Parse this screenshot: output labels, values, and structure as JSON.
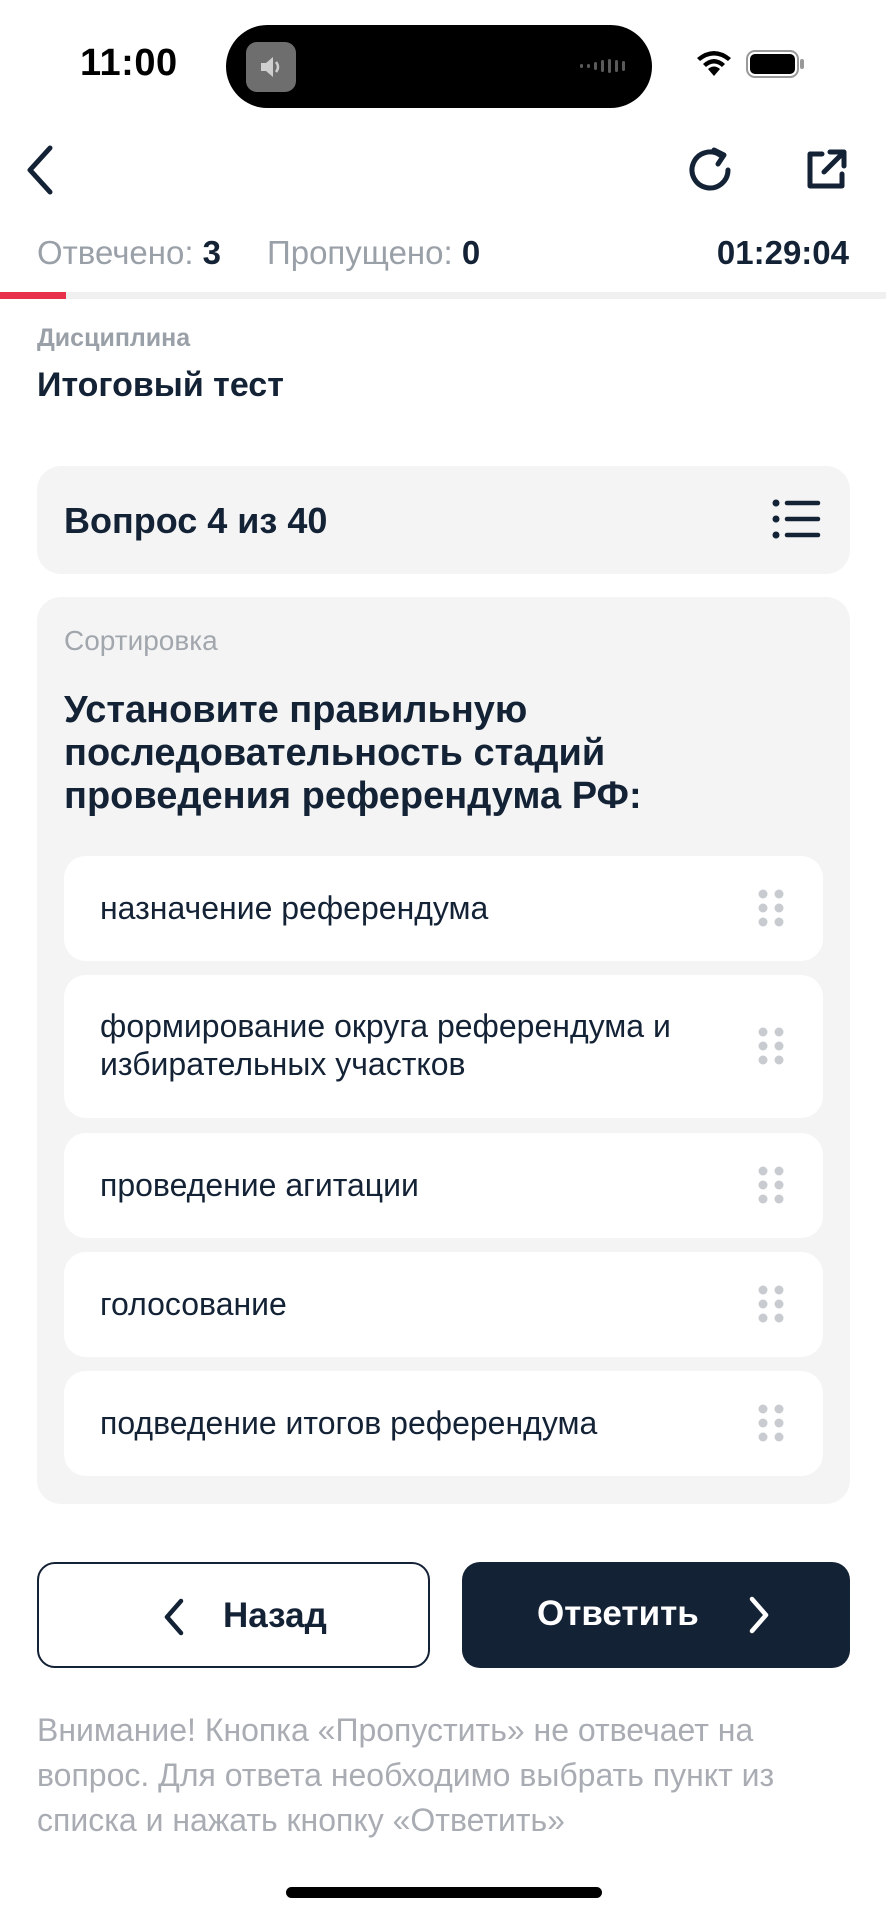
{
  "status_bar": {
    "time": "11:00"
  },
  "header": {
    "back_icon": "chevron-left-icon",
    "refresh_icon": "refresh-icon",
    "share_icon": "external-link-icon"
  },
  "stats": {
    "answered_label": "Отвечено:",
    "answered_value": "3",
    "skipped_label": "Пропущено:",
    "skipped_value": "0",
    "timer": "01:29:04",
    "progress_fraction": 0.075,
    "accent_color": "#e8304a"
  },
  "discipline": {
    "label": "Дисциплина",
    "title": "Итоговый тест"
  },
  "question": {
    "counter": "Вопрос 4 из 40",
    "type": "Сортировка",
    "text": "Установите правильную последовательность стадий проведения референдума РФ:",
    "options": [
      {
        "label": "назначение референдума"
      },
      {
        "label": "формирование округа референдума и избирательных участков"
      },
      {
        "label": "проведение агитации"
      },
      {
        "label": "голосование"
      },
      {
        "label": "подведение итогов референдума"
      }
    ]
  },
  "buttons": {
    "back_label": "Назад",
    "answer_label": "Ответить"
  },
  "notice": "Внимание! Кнопка «Пропустить» не отвечает на вопрос. Для ответа необходимо выбрать пункт из списка и нажать кнопку «Ответить»",
  "colors": {
    "primary": "#142236",
    "card_bg": "#f4f4f4",
    "muted_text": "#9aa0a8"
  }
}
